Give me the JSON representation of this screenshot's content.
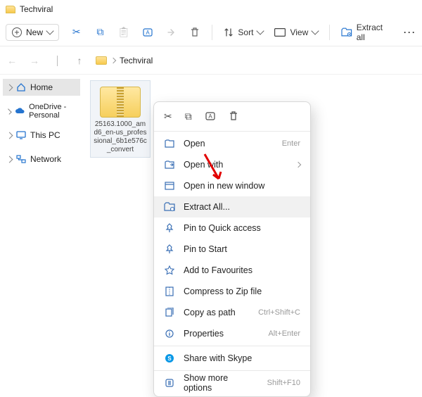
{
  "window": {
    "title": "Techviral"
  },
  "cmdbar": {
    "new_label": "New",
    "sort_label": "Sort",
    "view_label": "View",
    "extract_all_label": "Extract all"
  },
  "breadcrumb": {
    "current": "Techviral"
  },
  "sidebar": {
    "items": [
      {
        "label": "Home",
        "icon": "home-icon",
        "selected": true
      },
      {
        "label": "OneDrive - Personal",
        "icon": "cloud-icon",
        "selected": false
      },
      {
        "label": "This PC",
        "icon": "monitor-icon",
        "selected": false
      },
      {
        "label": "Network",
        "icon": "network-icon",
        "selected": false
      }
    ]
  },
  "content": {
    "files": [
      {
        "name": "25163.1000_amd6_en-us_professional_6b1e576c_convert"
      }
    ]
  },
  "context_menu": {
    "items": [
      {
        "label": "Open",
        "hint": "Enter",
        "icon": "open-icon"
      },
      {
        "label": "Open with",
        "hint": "",
        "icon": "open-with-icon",
        "submenu": true
      },
      {
        "label": "Open in new window",
        "hint": "",
        "icon": "new-window-icon"
      },
      {
        "label": "Extract All...",
        "hint": "",
        "icon": "extract-icon",
        "hovered": true
      },
      {
        "label": "Pin to Quick access",
        "hint": "",
        "icon": "pin-icon"
      },
      {
        "label": "Pin to Start",
        "hint": "",
        "icon": "pin-start-icon"
      },
      {
        "label": "Add to Favourites",
        "hint": "",
        "icon": "star-icon"
      },
      {
        "label": "Compress to Zip file",
        "hint": "",
        "icon": "zip-icon"
      },
      {
        "label": "Copy as path",
        "hint": "Ctrl+Shift+C",
        "icon": "copypath-icon"
      },
      {
        "label": "Properties",
        "hint": "Alt+Enter",
        "icon": "properties-icon"
      },
      {
        "label": "Share with Skype",
        "hint": "",
        "icon": "skype-icon",
        "sep_before": true
      },
      {
        "label": "Show more options",
        "hint": "Shift+F10",
        "icon": "more-icon",
        "sep_before": true
      }
    ]
  }
}
